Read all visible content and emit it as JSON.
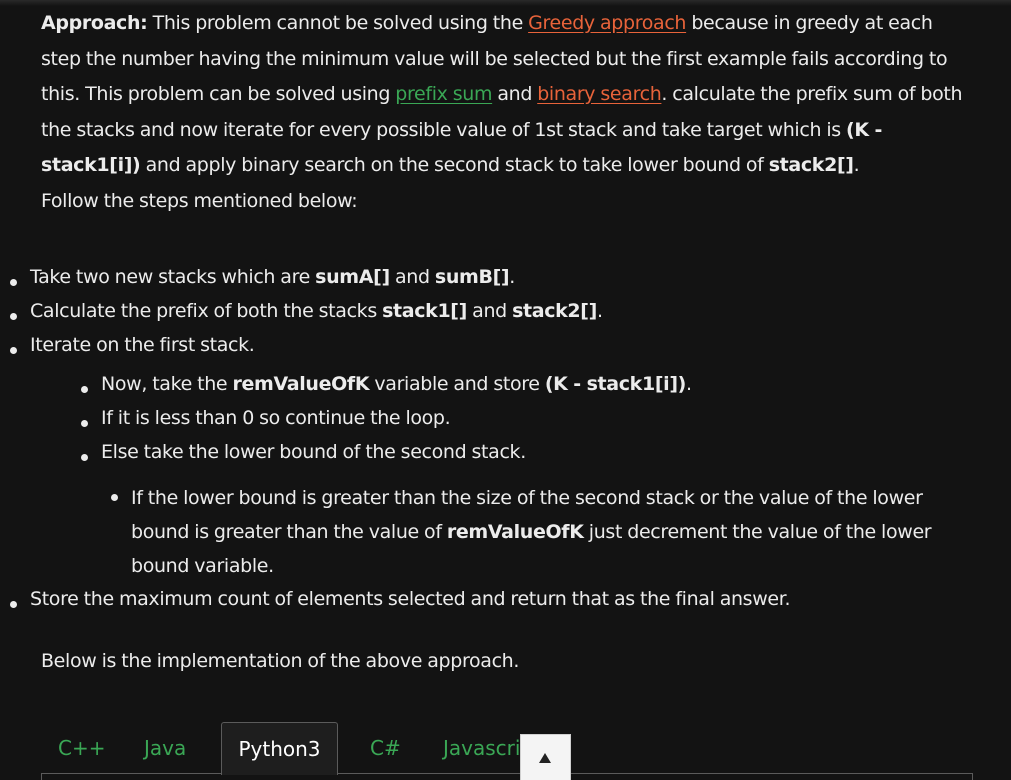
{
  "approach": {
    "label": "Approach:",
    "t1": " This problem cannot be solved using the ",
    "greedy_link": "Greedy approach",
    "t2": " because in greedy at each step the number having the minimum value will be selected but the first example fails according to this. This problem can be solved using ",
    "prefix_link": "prefix sum",
    "t3": " and ",
    "binary_link": "binary search",
    "t4": ". calculate the prefix sum of both the stacks and now iterate for every possible value of 1st stack and take target which is ",
    "target_expr": "(K - stack1[i])",
    "t5": " and apply binary search on the second stack to take lower bound of ",
    "stack2_name": "stack2[]",
    "t6": "."
  },
  "follow": "Follow the steps mentioned below:",
  "steps": {
    "s1_a": "Take two new stacks which are ",
    "s1_b": "sumA[]",
    "s1_c": " and ",
    "s1_d": "sumB[]",
    "s1_e": ".",
    "s2_a": "Calculate the prefix of both the stacks ",
    "s2_b": "stack1[]",
    "s2_c": " and ",
    "s2_d": "stack2[]",
    "s2_e": ".",
    "s3": "Iterate on the first stack.",
    "s3_1_a": "Now, take the ",
    "s3_1_b": "remValueOfK",
    "s3_1_c": " variable and store ",
    "s3_1_d": "(K - stack1[i])",
    "s3_1_e": ".",
    "s3_2": "If it is less than 0 so continue the loop.",
    "s3_3": "Else take the lower bound of the second stack.",
    "s3_3_1_a": "If the lower bound is greater than the size of the second stack or the value of the lower bound is greater than the value of ",
    "s3_3_1_b": "remValueOfK",
    "s3_3_1_c": " just decrement the value of the lower bound variable.",
    "s4": "Store the maximum count of elements selected and return that as the final answer."
  },
  "implementation_intro": "Below is the implementation of the above approach.",
  "tabs": [
    "C++",
    "Java",
    "Python3",
    "C#",
    "Javascript"
  ],
  "active_tab": "Python3",
  "colors": {
    "background": "#131313",
    "text": "#ececec",
    "link_orange": "#e8633a",
    "link_green": "#3aa755"
  },
  "icons": {
    "scroll_top": "up-arrow-icon"
  }
}
